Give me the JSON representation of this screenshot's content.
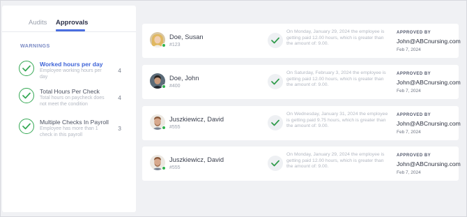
{
  "tabs": [
    {
      "label": "Audits",
      "active": false
    },
    {
      "label": "Approvals",
      "active": true
    }
  ],
  "warnings_heading": "WARNINGS",
  "warnings": [
    {
      "title": "Worked hours per day",
      "description": "Employee working hours per day",
      "count": "4",
      "active": true
    },
    {
      "title": "Total Hours Per Check",
      "description": "Total hours on paycheck does not meet the condition",
      "count": "4",
      "active": false
    },
    {
      "title": "Multiple Checks In Payroll",
      "description": "Employee has more than 1 check in this payroll",
      "count": "3",
      "active": false
    }
  ],
  "approvals": [
    {
      "name": "Doe, Susan",
      "id": "#123",
      "message": "On Monday, January 29, 2024 the employee is getting paid 12.00 hours, which is greater than the amount of: 9.00.",
      "approved_label": "APPROVED BY",
      "approved_by": "John@ABCnursing.com",
      "date": "Feb 7, 2024",
      "avatar": "woman-blonde"
    },
    {
      "name": "Doe, John",
      "id": "#400",
      "message": "On Saturday, February 3, 2024 the employee is getting paid 12.00 hours, which is greater than the amount of: 9.00.",
      "approved_label": "APPROVED BY",
      "approved_by": "John@ABCnursing.com",
      "date": "Feb 7, 2024",
      "avatar": "man-dark"
    },
    {
      "name": "Juszkiewicz, David",
      "id": "#555",
      "message": "On Wednesday, January 31, 2024 the employee is getting paid 9.75 hours, which is greater than the amount of: 9.00.",
      "approved_label": "APPROVED BY",
      "approved_by": "John@ABCnursing.com",
      "date": "Feb 7, 2024",
      "avatar": "man-beard"
    },
    {
      "name": "Juszkiewicz, David",
      "id": "#555",
      "message": "On Monday, January 29, 2024 the employee is getting paid 12.00 hours, which is greater than the amount of: 9.00.",
      "approved_label": "APPROVED BY",
      "approved_by": "John@ABCnursing.com",
      "date": "Feb 7, 2024",
      "avatar": "man-beard"
    }
  ],
  "colors": {
    "accent": "#4a6ee0",
    "check_green": "#34a853",
    "status_online": "#2fb24c"
  }
}
